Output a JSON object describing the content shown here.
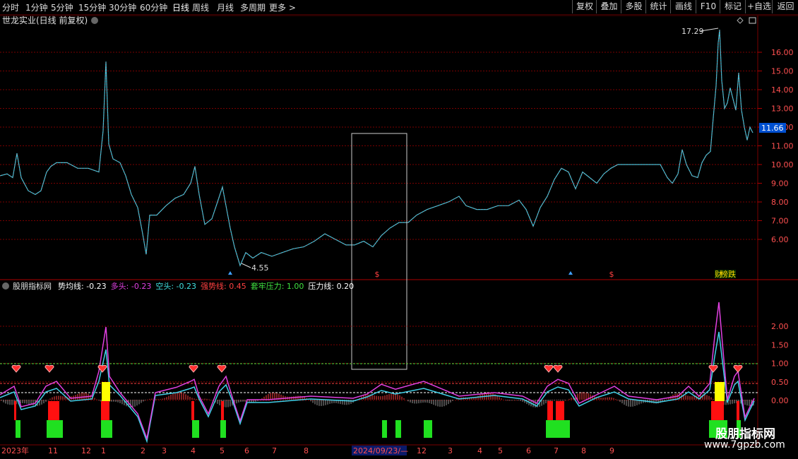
{
  "toolbar": {
    "periods": [
      "分时",
      "1分钟",
      "5分钟",
      "15分钟",
      "30分钟",
      "60分钟",
      "日线",
      "周线",
      "月线",
      "多周期",
      "更多 >"
    ],
    "active_period": "日线",
    "right_buttons": [
      "复权",
      "叠加",
      "多股",
      "统计",
      "画线",
      "F10",
      "标记",
      "+自选",
      "返回"
    ]
  },
  "main_panel": {
    "title": "世龙实业(日线 前复权)",
    "y_ticks": [
      "16.00",
      "15.00",
      "14.00",
      "13.00",
      "12.00",
      "11.00",
      "10.00",
      "9.00",
      "8.00",
      "7.00",
      "6.00"
    ],
    "current_price": "11.66",
    "high_label": "17.29",
    "low_label": "4.55",
    "event_marker": "$",
    "tag_text": "榜跌",
    "tag_prefix": "财"
  },
  "indicator_panel": {
    "title": "股朋指标网",
    "fields": [
      {
        "text": "势均线: -0.23",
        "color": "#ffffff"
      },
      {
        "text": "多头: -0.23",
        "color": "#e040e0"
      },
      {
        "text": "空头: -0.23",
        "color": "#40e0e0"
      },
      {
        "text": "强势线: 0.45",
        "color": "#ff4040"
      },
      {
        "text": "套牢压力: 1.00",
        "color": "#40e040"
      },
      {
        "text": "压力线: 0.20",
        "color": "#ffffff"
      }
    ],
    "y_ticks": [
      "2.00",
      "1.50",
      "1.00",
      "0.50",
      "0.00"
    ]
  },
  "time_axis": {
    "labels": [
      "2023年",
      "11",
      "12",
      "1",
      "2",
      "3",
      "4",
      "5",
      "6",
      "7",
      "8",
      "2024/09/23/—",
      "12",
      "3",
      "4",
      "5",
      "6",
      "7",
      "8",
      "9"
    ],
    "highlighted": "2024/09/23/—"
  },
  "watermark": {
    "line1": "股朋指标网",
    "line2": "www.7gpzb.com"
  },
  "colors": {
    "up": "#ff4040",
    "down": "#40e0e0",
    "grid": "#7a0000",
    "bg": "#000000"
  }
}
